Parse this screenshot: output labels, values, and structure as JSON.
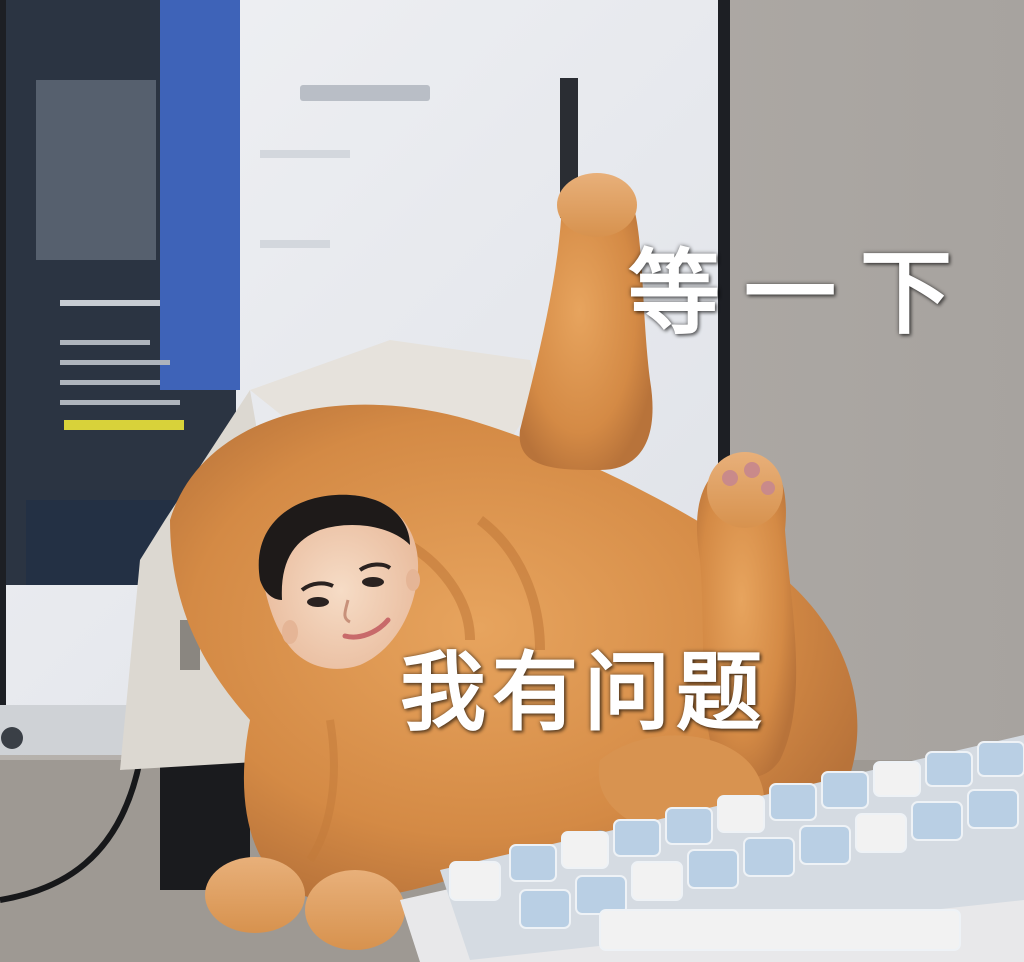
{
  "captions": {
    "top": "等一下",
    "bottom": "我有问题"
  }
}
